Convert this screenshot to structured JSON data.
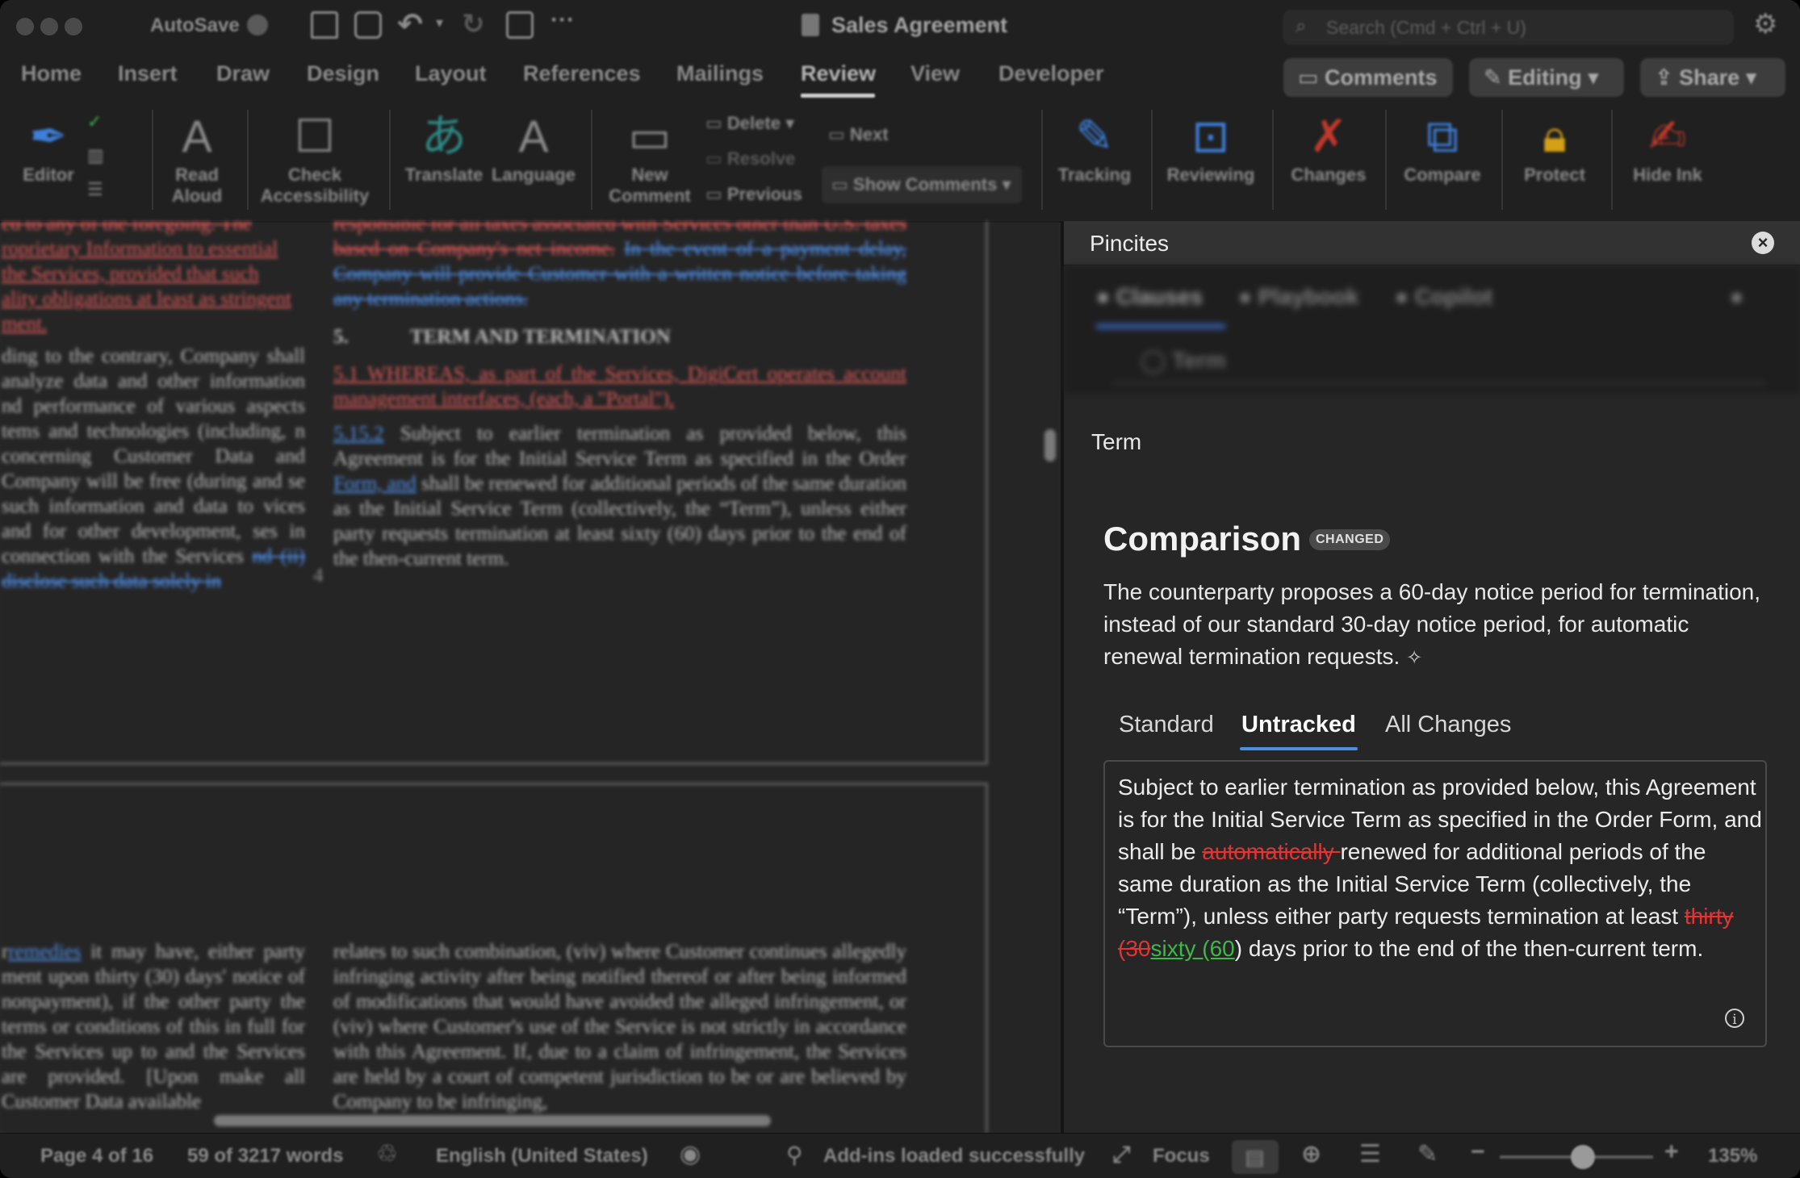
{
  "titlebar": {
    "autosave_label": "AutoSave",
    "doc_title": "Sales Agreement",
    "search_placeholder": "Search (Cmd + Ctrl + U)"
  },
  "tabs": [
    "Home",
    "Insert",
    "Draw",
    "Design",
    "Layout",
    "References",
    "Mailings",
    "Review",
    "View",
    "Developer"
  ],
  "active_tab": "Review",
  "header_buttons": {
    "comments": "Comments",
    "editing": "Editing",
    "share": "Share"
  },
  "ribbon": {
    "editor": "Editor",
    "read_aloud": "Read Aloud",
    "check_accessibility": "Check Accessibility",
    "translate": "Translate",
    "language": "Language",
    "new_comment": "New Comment",
    "delete": "Delete",
    "resolve": "Resolve",
    "previous": "Previous",
    "next": "Next",
    "show_comments": "Show Comments",
    "tracking": "Tracking",
    "reviewing": "Reviewing",
    "changes": "Changes",
    "compare": "Compare",
    "protect": "Protect",
    "hide_ink": "Hide Ink"
  },
  "document": {
    "left_col_top": [
      "ed to any of the foregoing. The",
      "roprietary Information to essential",
      "the Services, provided that such",
      "ality obligations at least as stringent",
      "ment."
    ],
    "left_col_mid": "ding to the contrary, Company shall analyze data and other information nd performance of various aspects tems and technologies (including, n concerning Customer Data and Company will be free (during and se such information and data to vices and for other development, ses in connection with the Services",
    "left_col_mid_ins": "nd (ii) disclose such data solely in",
    "right_col_top_del": "responsible for all taxes associated with Services other than U.S. taxes based on Company's net income.",
    "right_col_top_ins": "In the event of a payment delay, Company will provide Customer with a written notice before taking any termination actions.",
    "section_number": "5.",
    "section_heading": "TERM AND TERMINATION",
    "clause_51": "5.1      WHEREAS, as part of the Services, DigiCert operates account management interfaces, (each, a \"Portal\").",
    "clause_52_num": "5.15.2",
    "clause_52_a": "Subject to earlier termination as provided below, this Agreement is for the Initial Service Term as specified in the Order",
    "clause_52_ins": "Form, and",
    "clause_52_b": "shall be renewed for additional periods of the same duration as the Initial Service Term (collectively, the “Term”), unless either party requests termination at least sixty (60) days prior to the end of the then-current term.",
    "page_marker": "4",
    "lower_left_ins": "remedies",
    "lower_left_a": "r",
    "lower_left_b": "it may have, either party ment upon thirty (30) days' notice of nonpayment), if the other party the terms or conditions of this in full for the Services up to and the Services are provided. [Upon make all Customer Data available",
    "lower_right": "relates to such combination, (viv) where Customer continues allegedly infringing activity after being notified thereof or after being informed of modifications that would have avoided the alleged infringement, or (viv) where Customer's use of the Service is not strictly in accordance with this Agreement. If, due to a claim of infringement, the Services are held by a court of competent jurisdiction to be or are believed by Company to be infringing,"
  },
  "panel": {
    "title": "Pincites",
    "nav_items": [
      "Clauses",
      "Playbook",
      "Copilot"
    ],
    "nav_sub": "Term",
    "section_label": "Term",
    "comparison_title": "Comparison",
    "badge": "CHANGED",
    "description": "The counterparty proposes a 60-day notice period for termination, instead of our standard 30-day notice period, for automatic renewal termination requests.",
    "view_tabs": [
      "Standard",
      "Untracked",
      "All Changes"
    ],
    "active_view_tab": "Untracked",
    "text": {
      "part1": "Subject to earlier termination as provided below, this Agreement is for the Initial Service Term as specified in the Order Form, and shall be ",
      "deleted1": "automatically ",
      "part2": "renewed for additional periods of the same duration as the Initial Service Term (collectively, the “Term”), unless either party requests termination at least ",
      "deleted2": "thirty (30",
      "inserted2": "sixty (60",
      "part3": ") days prior to the end of the then-current term."
    }
  },
  "status": {
    "page": "Page 4 of 16",
    "words": "59 of 3217 words",
    "language": "English (United States)",
    "addins": "Add-ins loaded successfully",
    "focus": "Focus",
    "zoom": "135%"
  }
}
